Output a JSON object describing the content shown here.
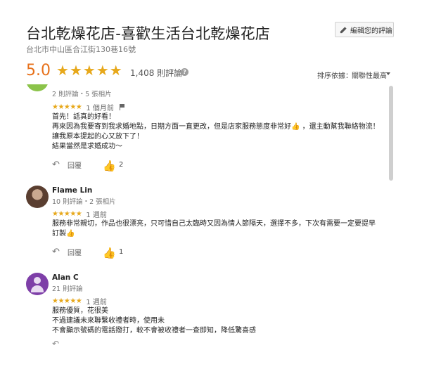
{
  "place": {
    "title": "台北乾燥花店-喜歡生活台北乾燥花店",
    "address": "台北市中山區合江街130巷16號"
  },
  "edit_review": {
    "label": "編輯您的評論",
    "icon": "pencil-icon"
  },
  "rating": {
    "score": "5.0",
    "stars": 5,
    "count_text": "1,408 則評論",
    "help_icon": "?"
  },
  "sort": {
    "label": "排序依據：",
    "value": "關聯性最高"
  },
  "colors": {
    "star": "#e7a81b",
    "score": "#e7711b",
    "like_active": "#1e88e5"
  },
  "reviews": [
    {
      "name": "",
      "meta": "2 則評論・5 張相片",
      "stars": "★★★★★",
      "date": "1 個月前",
      "lines": [
        "首先！話真的好看！",
        "再來因為我要寄到我求婚地點，日期方面一直更改，但是店家服務態度非常好👍 ，還主動幫我聯絡物流！",
        "讓我原本提起的心又放下了！",
        "結果當然是求婚成功～"
      ],
      "reply_label": "回覆",
      "likes": "2"
    },
    {
      "name": "Flame Lin",
      "meta": "10 則評論・2 張相片",
      "stars": "★★★★★",
      "date": "1 週前",
      "lines": [
        "服務非常親切，作品也很漂亮，只可惜自己太臨時又因為情人節隔天，選擇不多，下次有需要一定要提早",
        "訂製👍"
      ],
      "reply_label": "回覆",
      "likes": "1"
    },
    {
      "name": "Alan C",
      "meta": "21 則評論",
      "stars": "★★★★★",
      "date": "1 週前",
      "lines": [
        "服務優質，花很美",
        "不過建議未來聯繫收禮者時，使用未",
        "不會顯示號碼的電話撥打，較不會被收禮者一查即知，降低驚喜感"
      ]
    }
  ]
}
